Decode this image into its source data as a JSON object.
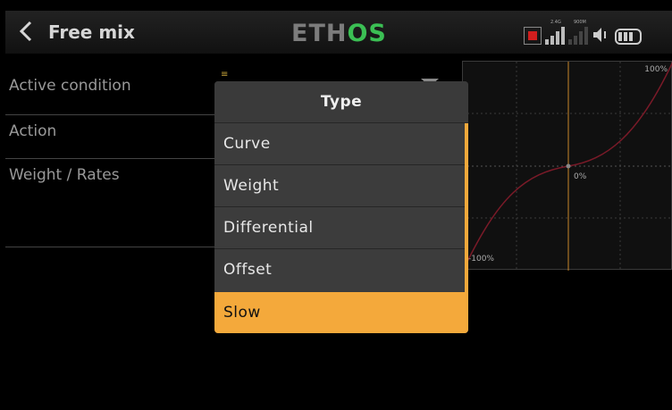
{
  "header": {
    "title": "Free mix",
    "logo_part1": "ETH",
    "logo_part2": "OS",
    "rx1_label": "2.4G",
    "rx2_label": "900M"
  },
  "form": {
    "rows": [
      {
        "label": "Active condition"
      },
      {
        "label": "Action"
      },
      {
        "label": "Weight / Rates"
      }
    ]
  },
  "graph": {
    "max_label": "100%",
    "mid_label": "0%",
    "min_label": "-100%",
    "curve_color": "#7a1a28",
    "center_line_color": "#c8862a"
  },
  "dialog": {
    "title": "Type",
    "options": [
      "Curve",
      "Weight",
      "Differential",
      "Offset",
      "Slow"
    ],
    "selected": "Slow",
    "accent": "#f4a93b"
  }
}
